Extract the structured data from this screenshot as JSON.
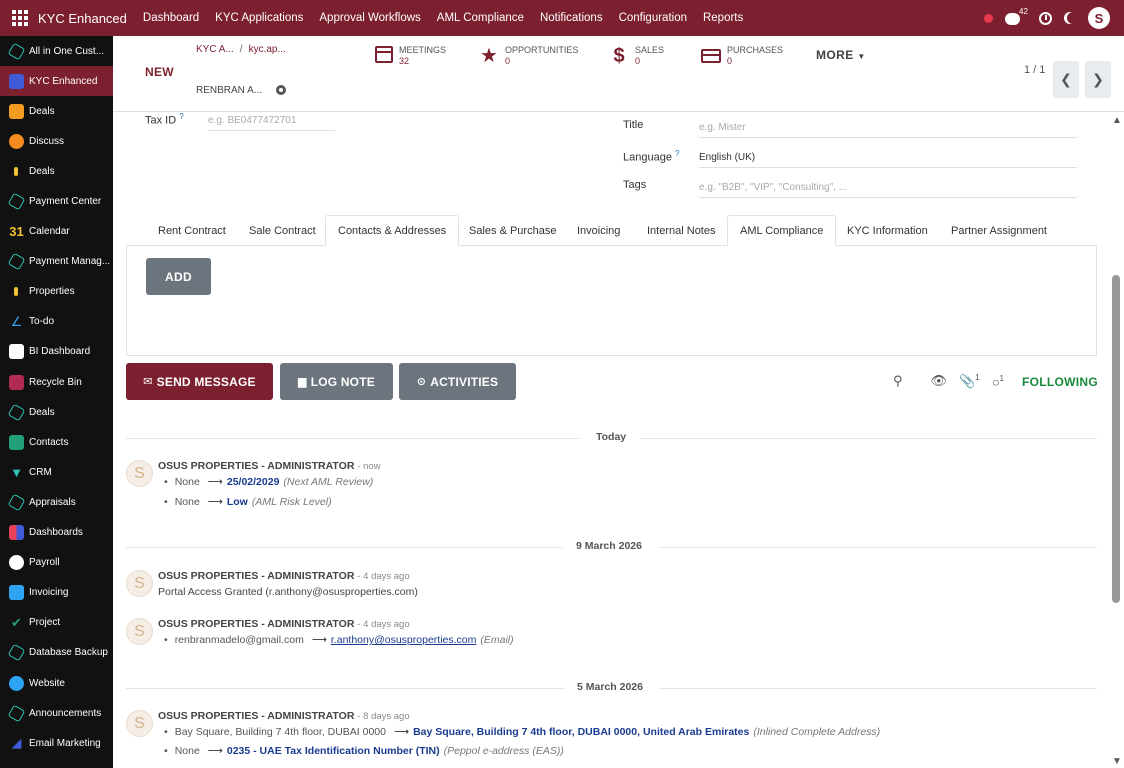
{
  "topbar": {
    "brand": "KYC Enhanced",
    "menu": [
      "Dashboard",
      "KYC Applications",
      "Approval Workflows",
      "AML Compliance",
      "Notifications",
      "Configuration",
      "Reports"
    ],
    "chat_count": "42",
    "avatar_letter": "S",
    "color": "#7c1f2e"
  },
  "sidebar": {
    "items": [
      {
        "label": "All in One Cust...",
        "icon": "hexagon-icon"
      },
      {
        "label": "KYC Enhanced",
        "icon": "kyc-icon",
        "active": true
      },
      {
        "label": "Deals",
        "icon": "chart-icon"
      },
      {
        "label": "Discuss",
        "icon": "discuss-icon"
      },
      {
        "label": "Deals",
        "icon": "tag-icon"
      },
      {
        "label": "Payment Center",
        "icon": "hexagon-icon"
      },
      {
        "label": "Calendar",
        "icon": "calendar-icon"
      },
      {
        "label": "Payment Manag...",
        "icon": "hexagon-icon"
      },
      {
        "label": "Properties",
        "icon": "tag-icon"
      },
      {
        "label": "To-do",
        "icon": "todo-icon"
      },
      {
        "label": "BI Dashboard",
        "icon": "bi-icon"
      },
      {
        "label": "Recycle Bin",
        "icon": "recycle-icon"
      },
      {
        "label": "Deals",
        "icon": "hexagon-icon"
      },
      {
        "label": "Contacts",
        "icon": "contacts-icon"
      },
      {
        "label": "CRM",
        "icon": "crm-icon"
      },
      {
        "label": "Appraisals",
        "icon": "hexagon-icon"
      },
      {
        "label": "Dashboards",
        "icon": "dashboards-icon"
      },
      {
        "label": "Payroll",
        "icon": "payroll-icon"
      },
      {
        "label": "Invoicing",
        "icon": "invoicing-icon"
      },
      {
        "label": "Project",
        "icon": "project-icon"
      },
      {
        "label": "Database Backup",
        "icon": "hexagon-icon"
      },
      {
        "label": "Website",
        "icon": "website-icon"
      },
      {
        "label": "Announcements",
        "icon": "hexagon-icon"
      },
      {
        "label": "Email Marketing",
        "icon": "email-marketing-icon"
      }
    ]
  },
  "control_panel": {
    "breadcrumb_root": "KYC A...",
    "breadcrumb_current": "kyc.ap...",
    "new_label": "NEW",
    "record_name": "RENBRAN A...",
    "stats": [
      {
        "label": "MEETINGS",
        "value": "32",
        "icon": "calendar-icon"
      },
      {
        "label": "OPPORTUNITIES",
        "value": "0",
        "icon": "star-icon"
      },
      {
        "label": "SALES",
        "value": "0",
        "icon": "dollar-icon"
      },
      {
        "label": "PURCHASES",
        "value": "0",
        "icon": "credit-card-icon"
      }
    ],
    "more_label": "MORE",
    "pager": "1 / 1"
  },
  "form": {
    "tax_id_label": "Tax ID",
    "tax_id_placeholder": "e.g. BE0477472701",
    "title_label": "Title",
    "title_placeholder": "e.g. Mister",
    "language_label": "Language",
    "language_value": "English (UK)",
    "tags_label": "Tags",
    "tags_placeholder": "e.g. \"B2B\", \"VIP\", \"Consulting\", ...",
    "help_mark": "?",
    "tabs": [
      "Rent Contract",
      "Sale Contract",
      "Contacts & Addresses",
      "Sales & Purchase",
      "Invoicing",
      "Internal Notes",
      "AML Compliance",
      "KYC Information",
      "Partner Assignment"
    ],
    "add_label": "ADD"
  },
  "chatter": {
    "send_message": "SEND MESSAGE",
    "log_note": "LOG NOTE",
    "activities": "ACTIVITIES",
    "attachments_count": "1",
    "followers_count": "1",
    "following": "FOLLOWING",
    "days": [
      {
        "label": "Today",
        "messages": [
          {
            "author": "OSUS PROPERTIES - ADMINISTRATOR",
            "when": "now",
            "changes": [
              {
                "old": "None",
                "new": "25/02/2029",
                "field": "(Next AML Review)"
              },
              {
                "old": "None",
                "new": "Low",
                "field": "(AML Risk Level)"
              }
            ]
          }
        ]
      },
      {
        "label": "9 March 2026",
        "messages": [
          {
            "author": "OSUS PROPERTIES - ADMINISTRATOR",
            "when": "4 days ago",
            "body": "Portal Access Granted (r.anthony@osusproperties.com)"
          },
          {
            "author": "OSUS PROPERTIES - ADMINISTRATOR",
            "when": "4 days ago",
            "changes": [
              {
                "old": "renbranmadelo@gmail.com",
                "new": "r.anthony@osusproperties.com",
                "field": "(Email)"
              }
            ]
          }
        ]
      },
      {
        "label": "5 March 2026",
        "messages": [
          {
            "author": "OSUS PROPERTIES - ADMINISTRATOR",
            "when": "8 days ago",
            "changes": [
              {
                "old": "Bay Square, Building 7 4th floor, DUBAI 0000",
                "new": "Bay Square, Building 7 4th floor, DUBAI 0000, United Arab Emirates",
                "field": "(Inlined Complete Address)"
              },
              {
                "old": "None",
                "new": "0235 - UAE Tax Identification Number (TIN)",
                "field": "(Peppol e-address (EAS))"
              }
            ]
          }
        ]
      }
    ]
  }
}
